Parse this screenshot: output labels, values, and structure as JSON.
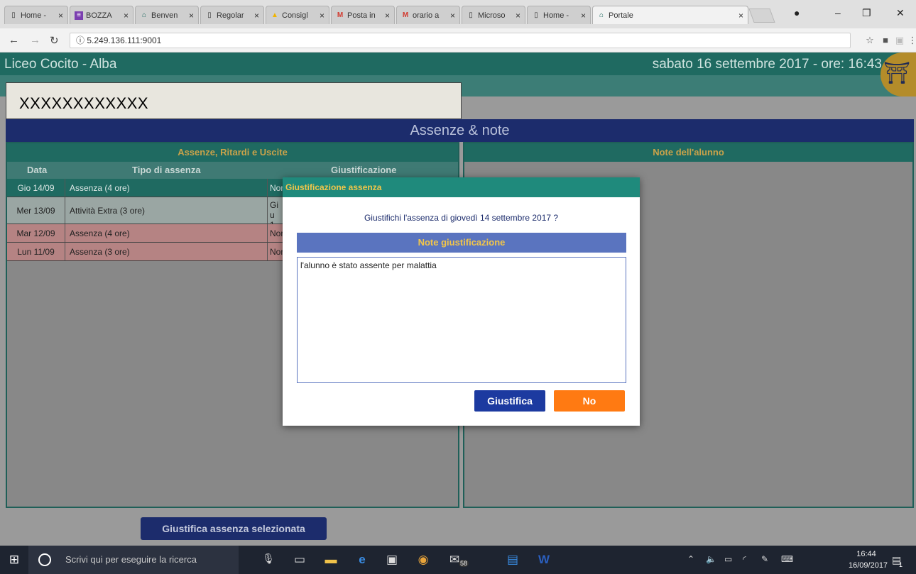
{
  "browser": {
    "tabs": [
      {
        "label": "Home -",
        "icon": "page-icon"
      },
      {
        "label": "BOZZA",
        "icon": "sheets-icon"
      },
      {
        "label": "Benven",
        "icon": "school-icon"
      },
      {
        "label": "Regolar",
        "icon": "page-icon"
      },
      {
        "label": "Consigl",
        "icon": "drive-icon"
      },
      {
        "label": "Posta in",
        "icon": "gmail-icon"
      },
      {
        "label": "orario a",
        "icon": "gmail-icon"
      },
      {
        "label": "Microso",
        "icon": "page-icon"
      },
      {
        "label": "Home -",
        "icon": "page-icon"
      },
      {
        "label": "Portale",
        "icon": "school-icon"
      }
    ],
    "url": "5.249.136.111:9001"
  },
  "header": {
    "school": "Liceo Cocito - Alba",
    "datetime": "sabato 16 settembre 2017 - ore: 16:43",
    "student": "XXXXXXXXXXXX"
  },
  "main": {
    "title": "Assenze & note",
    "left_panel": {
      "title": "Assenze, Ritardi e Uscite",
      "columns": [
        "Data",
        "Tipo di assenza",
        "Giustificazione"
      ],
      "rows": [
        {
          "date": "Gio 14/09",
          "type": "Assenza (4 ore)",
          "just": "Nor"
        },
        {
          "date": "Mer 13/09",
          "type": "Attività Extra (3 ore)",
          "just": "Giu 13/"
        },
        {
          "date": "Mar 12/09",
          "type": "Assenza (4 ore)",
          "just": "Nor"
        },
        {
          "date": "Lun 11/09",
          "type": "Assenza (3 ore)",
          "just": "Nor"
        }
      ]
    },
    "right_panel": {
      "title": "Note dell'alunno"
    },
    "action_button": "Giustifica assenza selezionata"
  },
  "dialog": {
    "title": "Giustificazione assenza",
    "question": "Giustifichi l'assenza di giovedì 14 settembre 2017 ?",
    "notes_header": "Note giustificazione",
    "notes_value": "l'alunno è stato assente per malattia",
    "confirm": "Giustifica",
    "cancel": "No"
  },
  "taskbar": {
    "search_placeholder": "Scrivi qui per eseguire la ricerca",
    "mail_badge": "58",
    "time": "16:44",
    "date": "16/09/2017",
    "notifications": "1"
  },
  "colors": {
    "header_teal": "#1f6a61",
    "title_navy": "#1c2c6c",
    "dialog_teal": "#1f8a7c",
    "accent_orange": "#ff7a12",
    "label_gold": "#c9a24a"
  }
}
